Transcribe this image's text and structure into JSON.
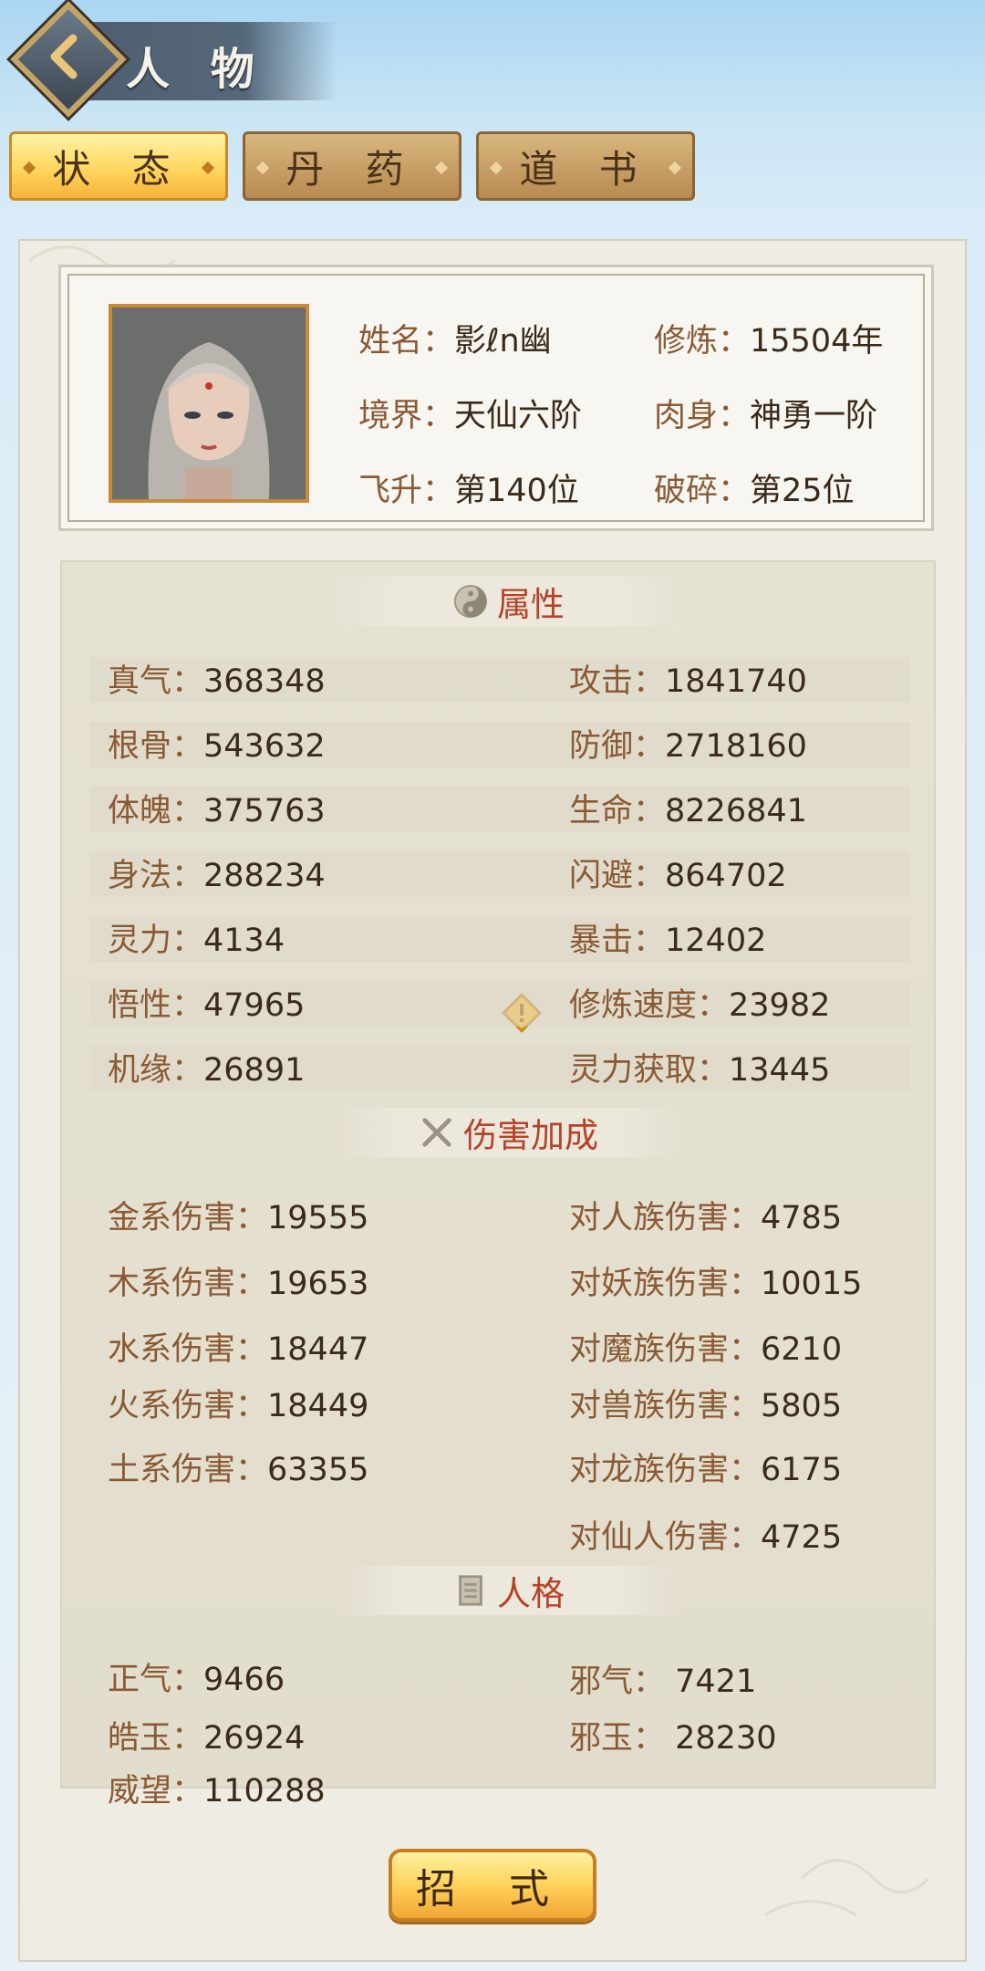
{
  "header": {
    "title": "人 物"
  },
  "tabs": [
    {
      "label": "状 态",
      "active": true
    },
    {
      "label": "丹 药",
      "active": false
    },
    {
      "label": "道 书",
      "active": false
    }
  ],
  "profile": {
    "name_key": "姓名：",
    "name": "影ℓn幽",
    "cultivate_key": "修炼：",
    "cultivate": "15504年",
    "realm_key": "境界：",
    "realm": "天仙六阶",
    "body_key": "肉身：",
    "body": "神勇一阶",
    "ascend_key": "飞升：",
    "ascend": "第140位",
    "shatter_key": "破碎：",
    "shatter": "第25位"
  },
  "sections": {
    "attributes": "属性",
    "damage": "伤害加成",
    "personality": "人格"
  },
  "attributes_left": [
    {
      "k": "真气：",
      "v": "368348"
    },
    {
      "k": "根骨：",
      "v": "543632"
    },
    {
      "k": "体魄：",
      "v": "375763"
    },
    {
      "k": "身法：",
      "v": "288234"
    },
    {
      "k": "灵力：",
      "v": "4134"
    },
    {
      "k": "悟性：",
      "v": "47965"
    },
    {
      "k": "机缘：",
      "v": "26891"
    }
  ],
  "attributes_right": [
    {
      "k": "攻击：",
      "v": "1841740"
    },
    {
      "k": "防御：",
      "v": "2718160"
    },
    {
      "k": "生命：",
      "v": "8226841"
    },
    {
      "k": "闪避：",
      "v": "864702"
    },
    {
      "k": "暴击：",
      "v": "12402"
    },
    {
      "k": "修炼速度：",
      "v": "23982"
    },
    {
      "k": "灵力获取：",
      "v": "13445"
    }
  ],
  "damage_left": [
    {
      "k": "金系伤害：",
      "v": "19555"
    },
    {
      "k": "木系伤害：",
      "v": "19653"
    },
    {
      "k": "水系伤害：",
      "v": "18447"
    },
    {
      "k": "火系伤害：",
      "v": "18449"
    },
    {
      "k": "土系伤害：",
      "v": "63355"
    }
  ],
  "damage_right": [
    {
      "k": "对人族伤害：",
      "v": "4785"
    },
    {
      "k": "对妖族伤害：",
      "v": "10015"
    },
    {
      "k": "对魔族伤害：",
      "v": "6210"
    },
    {
      "k": "对兽族伤害：",
      "v": "5805"
    },
    {
      "k": "对龙族伤害：",
      "v": "6175"
    },
    {
      "k": "对仙人伤害：",
      "v": "4725"
    }
  ],
  "personality_left": [
    {
      "k": "正气：",
      "v": "9466"
    },
    {
      "k": "皓玉：",
      "v": "26924"
    },
    {
      "k": "威望：",
      "v": "110288"
    }
  ],
  "personality_right": [
    {
      "k": "邪气：",
      "v": " 7421"
    },
    {
      "k": "邪玉：",
      "v": " 28230"
    }
  ],
  "bottom_button": "招 式",
  "colors": {
    "accent_red": "#b5432a",
    "gold": "#ffd25a",
    "header_slate": "#4d5e6f"
  }
}
